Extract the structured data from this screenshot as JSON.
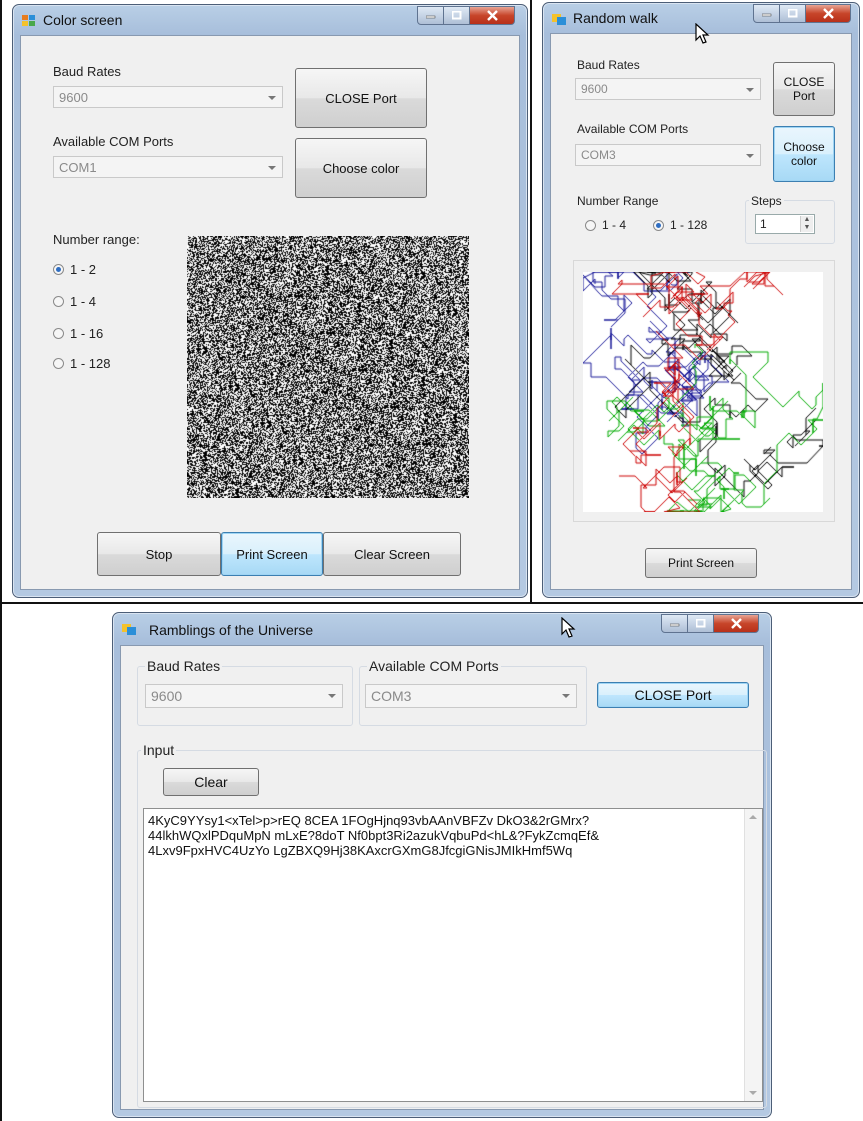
{
  "color_screen": {
    "title": "Color screen",
    "baud_label": "Baud Rates",
    "baud_value": "9600",
    "ports_label": "Available COM Ports",
    "port_value": "COM1",
    "close_port": "CLOSE Port",
    "choose_color": "Choose color",
    "range_label": "Number range:",
    "ranges": [
      "1 - 2",
      "1 - 4",
      "1 - 16",
      "1 - 128"
    ],
    "selected_range": "1 - 2",
    "stop": "Stop",
    "print_screen": "Print Screen",
    "clear_screen": "Clear Screen"
  },
  "random_walk": {
    "title": "Random walk",
    "baud_label": "Baud Rates",
    "baud_value": "9600",
    "ports_label": "Available COM Ports",
    "port_value": "COM3",
    "close_port": "CLOSE Port",
    "choose_color": "Choose color",
    "range_label": "Number Range",
    "ranges": [
      "1 - 4",
      "1 - 128"
    ],
    "selected_range": "1 - 128",
    "steps_label": "Steps",
    "steps_value": "1",
    "print_screen": "Print Screen",
    "walk_colors": [
      "#1a1a99",
      "#000000",
      "#00aa00",
      "#cc0000"
    ]
  },
  "ramblings": {
    "title": "Ramblings of the Universe",
    "baud_label": "Baud Rates",
    "baud_value": "9600",
    "ports_label": "Available COM Ports",
    "port_value": "COM3",
    "close_port": "CLOSE Port",
    "input_label": "Input",
    "clear": "Clear",
    "text_lines": [
      "4KyC9YYsy1<xTel>p>rEQ 8CEA 1FOgHjnq93vbAAnVBFZv DkO3&2rGMrx?",
      "44lkhWQxlPDquMpN mLxE?8doT Nf0bpt3Ri2azukVqbuPd<hL&?FykZcmqEf&",
      "4Lxv9FpxHVC4UzYo LgZBXQ9Hj38KAxcrGXmG8JfcgiGNisJMIkHmf5Wq"
    ]
  }
}
